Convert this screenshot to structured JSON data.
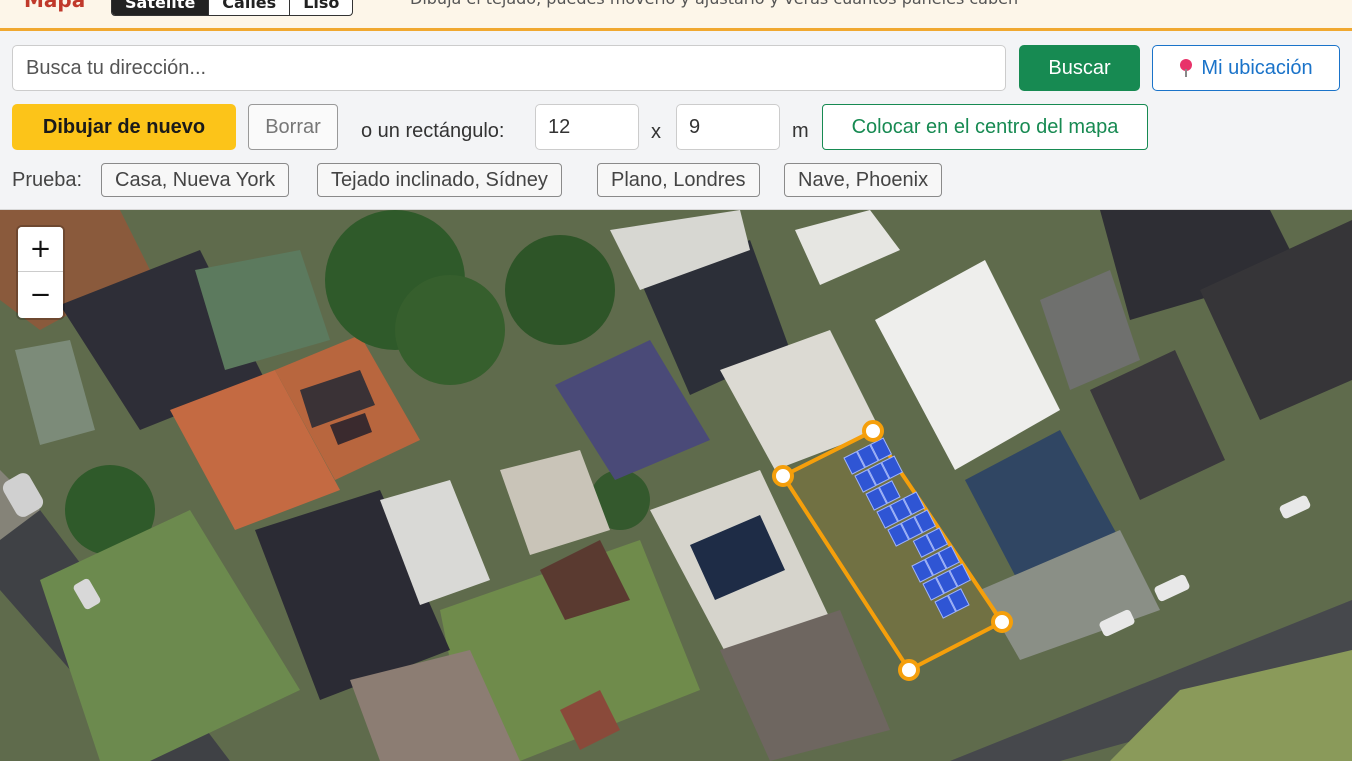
{
  "header": {
    "title": "Mapa",
    "map_modes": [
      "Satélite",
      "Calles",
      "Liso"
    ],
    "active_mode": "Satélite",
    "hint": "Dibuja el tejado, puedes moverlo y ajustarlo y verás cuántos paneles caben"
  },
  "search": {
    "placeholder": "Busca tu dirección...",
    "value": "",
    "button_label": "Buscar",
    "location_label": "Mi ubicación",
    "location_icon": "pin-icon"
  },
  "drawing": {
    "redraw_label": "Dibujar de nuevo",
    "clear_label": "Borrar",
    "rectangle_label": "o un rectángulo:",
    "width_value": "12",
    "times_label": "x",
    "height_value": "9",
    "unit_label": "m",
    "center_label": "Colocar en el centro del mapa"
  },
  "examples": {
    "label": "Prueba:",
    "items": [
      "Casa, Nueva York",
      "Tejado inclinado, Sídney",
      "Plano, Londres",
      "Nave, Phoenix"
    ]
  },
  "map": {
    "zoom_in": "+",
    "zoom_out": "−",
    "roof_outline_color": "#f59f0b",
    "panel_color": "#2f55d4",
    "view": "satellite"
  }
}
